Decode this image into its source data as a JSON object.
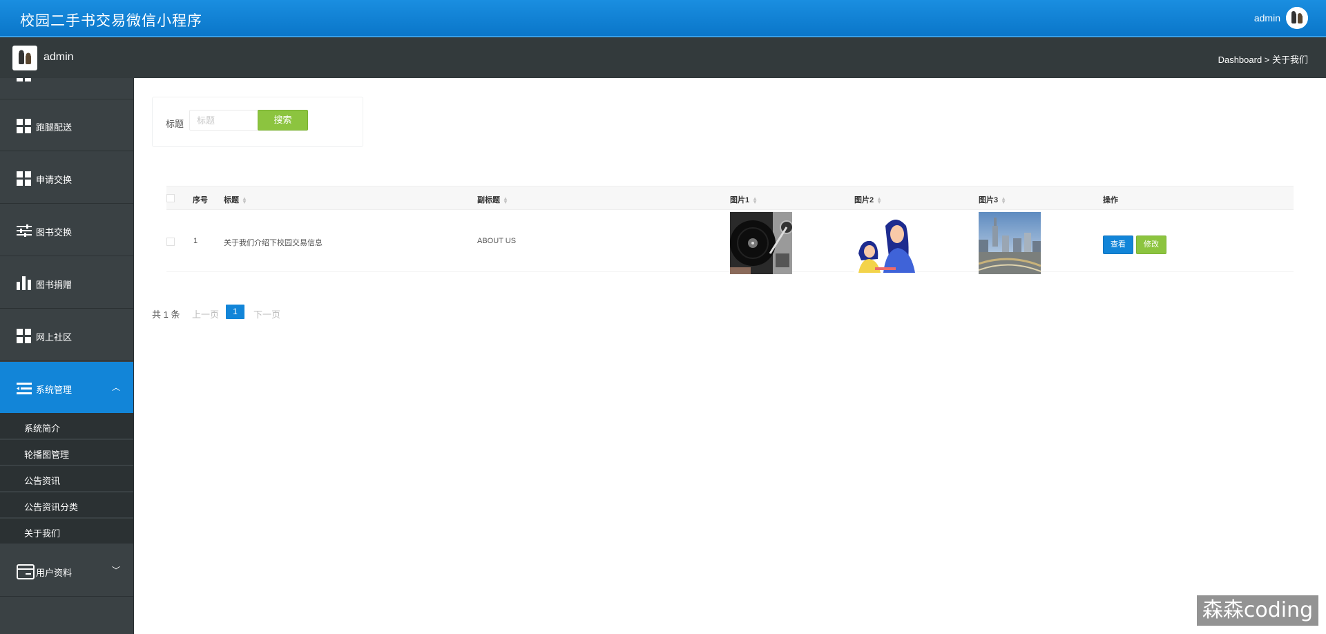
{
  "app": {
    "title": "校园二手书交易微信小程序"
  },
  "header": {
    "user": "admin",
    "avatar_icon": "bear-avatar-icon"
  },
  "subheader": {
    "name": "admin",
    "breadcrumb": "Dashboard > 关于我们"
  },
  "sidebar": {
    "items": [
      {
        "label": "跑腿配送",
        "icon": "grid-icon"
      },
      {
        "label": "申请交换",
        "icon": "grid-icon"
      },
      {
        "label": "图书交换",
        "icon": "sliders-icon"
      },
      {
        "label": "图书捐赠",
        "icon": "bar-chart-icon"
      },
      {
        "label": "网上社区",
        "icon": "grid-icon"
      },
      {
        "label": "系统管理",
        "icon": "list-menu-icon",
        "active": true,
        "expanded": true
      },
      {
        "label": "用户资料",
        "icon": "card-icon"
      }
    ],
    "submenu": [
      "系统简介",
      "轮播图管理",
      "公告资讯",
      "公告资讯分类",
      "关于我们"
    ]
  },
  "search": {
    "label": "标题",
    "placeholder": "标题",
    "value": "",
    "button": "搜索"
  },
  "table": {
    "columns": [
      "序号",
      "标题",
      "副标题",
      "图片1",
      "图片2",
      "图片3",
      "操作"
    ],
    "rows": [
      {
        "index": "1",
        "title": "关于我们介绍下校园交易信息",
        "subtitle": "ABOUT US",
        "image1": "turntable-photo",
        "image2": "illustration-girls",
        "image3": "city-photo",
        "actions": [
          "查看",
          "修改"
        ]
      }
    ]
  },
  "pagination": {
    "total": "共 1 条",
    "prev": "上一页",
    "page": "1",
    "next": "下一页"
  },
  "watermark": "森森coding",
  "colors": {
    "topbar": "#0a76c9",
    "sidebar": "#3a4144",
    "active": "#1285d8",
    "search_button": "#8cc43f",
    "view_button": "#1285d8",
    "edit_button": "#8cc43f"
  }
}
